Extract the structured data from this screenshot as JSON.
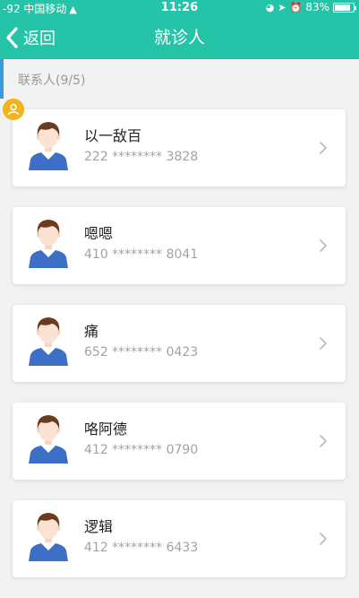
{
  "status_bar": {
    "signal": "-92 中国移动",
    "time": "11:26",
    "battery": "83%",
    "battery_level": 0.83,
    "icons": [
      "wifi-icon",
      "lock-rotation-icon",
      "location-arrow-icon",
      "alarm-icon",
      "battery-icon"
    ]
  },
  "navbar": {
    "back_label": "返回",
    "title": "就诊人"
  },
  "section": {
    "label": "联系人(9/5)"
  },
  "contacts": [
    {
      "name": "以一敌百",
      "phone": "222 ******** 3828"
    },
    {
      "name": "嗯嗯",
      "phone": "410 ******** 8041"
    },
    {
      "name": "痛",
      "phone": "652 ******** 0423"
    },
    {
      "name": "咯阿德",
      "phone": "412 ******** 0790"
    },
    {
      "name": "逻辑",
      "phone": "412 ******** 6433"
    }
  ],
  "colors": {
    "header": "#25c3a8",
    "section_bar": "#3a9bd9",
    "badge": "#f3b31a",
    "background": "#f2f2f2"
  }
}
